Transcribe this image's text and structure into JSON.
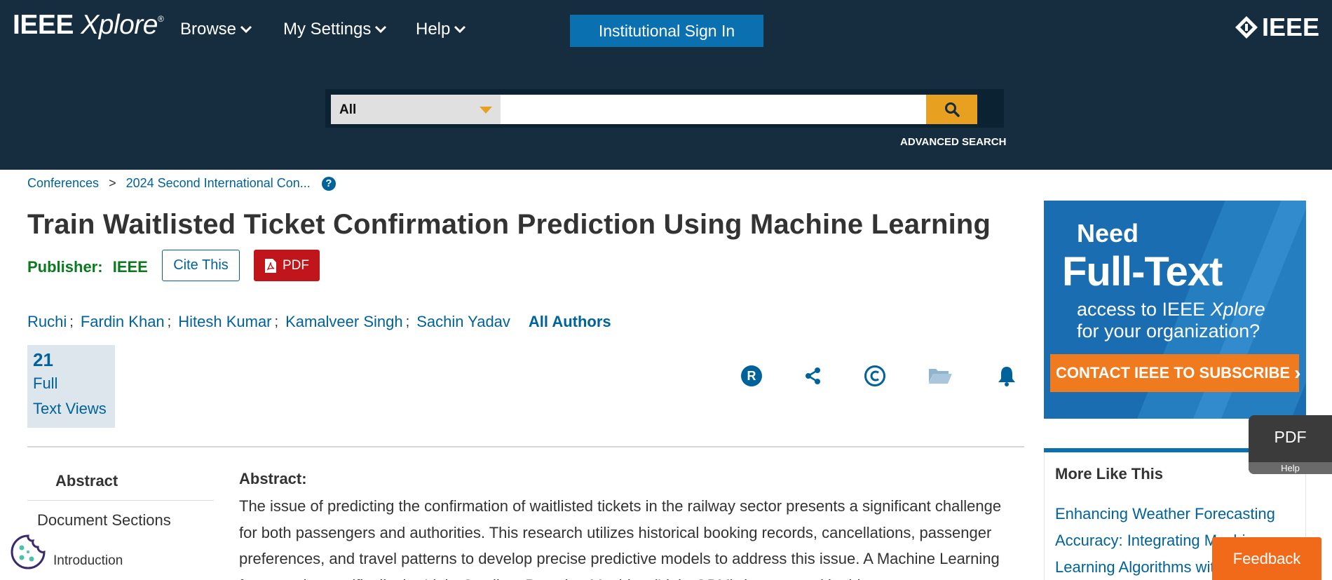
{
  "header": {
    "logo_main": "IEEE",
    "logo_sub": "Xplore",
    "logo_reg": "®",
    "nav": [
      {
        "label": "Browse"
      },
      {
        "label": "My Settings"
      },
      {
        "label": "Help"
      }
    ],
    "signin_label": "Institutional Sign In",
    "ieee_brand": "IEEE",
    "search": {
      "scope": "All",
      "placeholder": "",
      "advanced_label": "ADVANCED SEARCH"
    }
  },
  "breadcrumb": {
    "items": [
      "Conferences",
      "2024 Second International Con..."
    ],
    "separator": ">",
    "help_icon": "?"
  },
  "article": {
    "title": "Train Waitlisted Ticket Confirmation Prediction Using Machine Learning",
    "publisher_label": "Publisher:",
    "publisher_value": "IEEE",
    "cite_label": "Cite This",
    "pdf_label": "PDF",
    "authors": [
      "Ruchi",
      "Fardin Khan",
      "Hitesh Kumar",
      "Kamalveer Singh",
      "Sachin Yadav"
    ],
    "author_separator": ";",
    "all_authors_label": "All Authors",
    "metrics": {
      "count": "21",
      "line1": "Full",
      "line2": "Text Views"
    },
    "tools": [
      "rights-icon",
      "share-icon",
      "copyright-icon",
      "folder-icon",
      "bell-icon"
    ]
  },
  "left_nav": {
    "abstract": "Abstract",
    "document_sections": "Document Sections",
    "introduction": "Introduction"
  },
  "abstract": {
    "heading": "Abstract:",
    "text": "The issue of predicting the confirmation of waitlisted tickets in the railway sector presents a significant challenge for both passengers and authorities. This research utilizes historical booking records, cancellations, passenger preferences, and travel patterns to develop precise predictive models to address this issue. A Machine Learning framework, specifically the Light Gradient Boosting Machine (Light GBM), is proposed in this"
  },
  "ad": {
    "need": "Need",
    "full_text": "Full-Text",
    "line1_prefix": "access to IEEE ",
    "line1_italic": "Xplore",
    "line2": "for your organization?",
    "cta": "CONTACT IEEE TO SUBSCRIBE",
    "cta_arrow": "›"
  },
  "more_like_this": {
    "heading": "More Like This",
    "first_link": "Enhancing Weather Forecasting Accuracy: Integrating Machine Learning Algorithms with"
  },
  "floating": {
    "pdf_label": "PDF",
    "help_label": "Help",
    "feedback_label": "Feedback"
  },
  "colors": {
    "header_bg": "#152d3e",
    "link": "#00629b",
    "accent_orange": "#e8a020",
    "pdf_red": "#c0161b",
    "publisher_green": "#0a7a1e"
  }
}
